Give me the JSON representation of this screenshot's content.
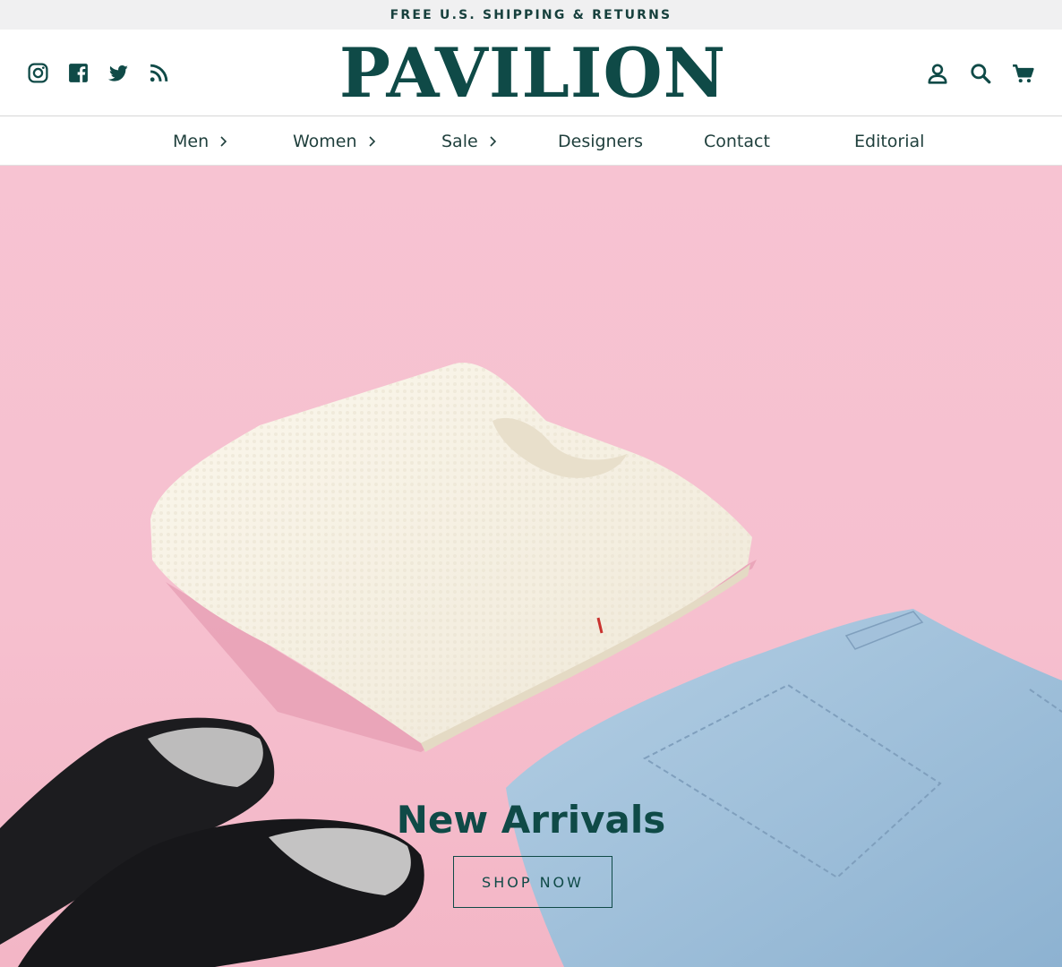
{
  "announcement": "FREE U.S. SHIPPING & RETURNS",
  "brand": {
    "logo_text": "PAVILION",
    "color": "#0f4a47"
  },
  "social_icons": [
    "instagram-icon",
    "facebook-icon",
    "twitter-icon",
    "rss-icon"
  ],
  "utility_icons": [
    "account-icon",
    "search-icon",
    "cart-icon"
  ],
  "nav": {
    "men": "Men",
    "women": "Women",
    "sale": "Sale",
    "designers": "Designers",
    "contact": "Contact",
    "editorial": "Editorial"
  },
  "hero": {
    "title": "New Arrivals",
    "button": "SHOP NOW",
    "background": "#f6c0cf"
  }
}
